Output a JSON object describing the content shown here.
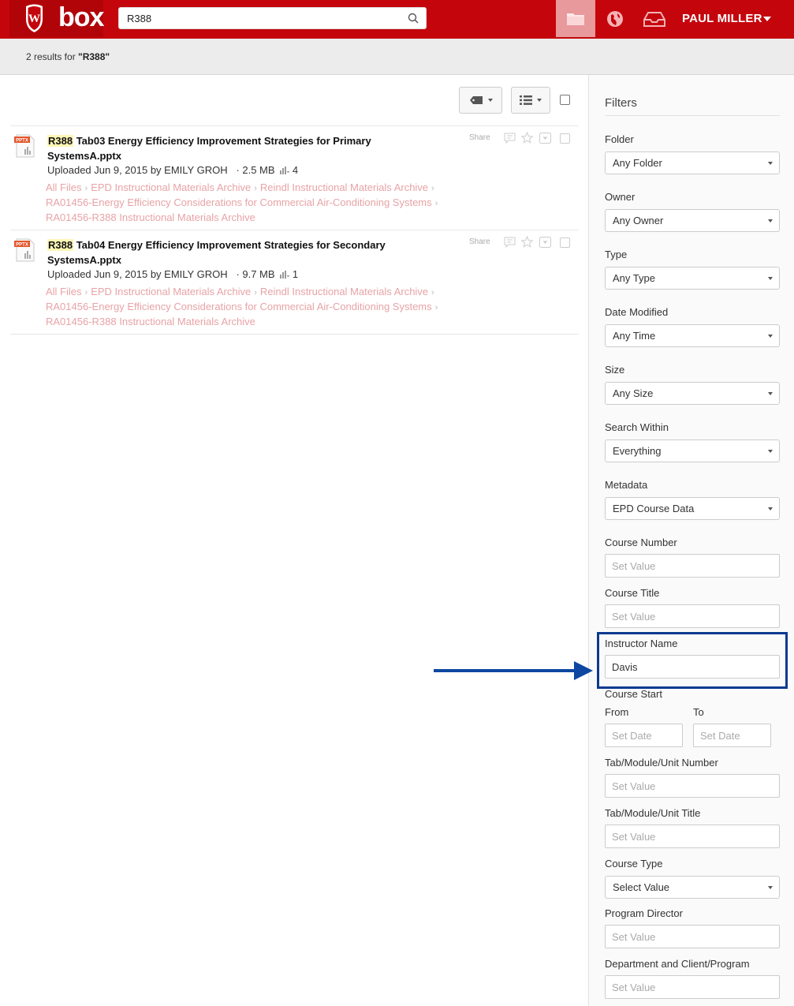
{
  "header": {
    "logo_text": "box",
    "search_value": "R388",
    "username": "PAUL MILLER"
  },
  "results": {
    "prefix": "2 results for ",
    "query_quoted": "\"R388\""
  },
  "files": [
    {
      "hit": "R388",
      "title_rest": " Tab03 Energy Efficiency Improvement Strategies for Primary SystemsA.pptx",
      "meta_prefix": "Uploaded Jun 9, 2015 by EMILY GROH",
      "size": "· 2.5 MB",
      "views": "4",
      "share": "Share",
      "file_type": "PPTX",
      "crumbs": [
        "All Files",
        "EPD Instructional Materials Archive",
        "Reindl Instructional Materials Archive",
        "RA01456-Energy Efficiency Considerations for Commercial Air-Conditioning Systems",
        "RA01456-R388 Instructional Materials Archive"
      ]
    },
    {
      "hit": "R388",
      "title_rest": " Tab04 Energy Efficiency Improvement Strategies for Secondary SystemsA.pptx",
      "meta_prefix": "Uploaded Jun 9, 2015 by EMILY GROH",
      "size": "· 9.7 MB",
      "views": "1",
      "share": "Share",
      "file_type": "PPTX",
      "crumbs": [
        "All Files",
        "EPD Instructional Materials Archive",
        "Reindl Instructional Materials Archive",
        "RA01456-Energy Efficiency Considerations for Commercial Air-Conditioning Systems",
        "RA01456-R388 Instructional Materials Archive"
      ]
    }
  ],
  "filters": {
    "title": "Filters",
    "folder": {
      "label": "Folder",
      "value": "Any Folder"
    },
    "owner": {
      "label": "Owner",
      "value": "Any Owner"
    },
    "type": {
      "label": "Type",
      "value": "Any Type"
    },
    "date_modified": {
      "label": "Date Modified",
      "value": "Any Time"
    },
    "size": {
      "label": "Size",
      "value": "Any Size"
    },
    "search_within": {
      "label": "Search Within",
      "value": "Everything"
    },
    "metadata": {
      "label": "Metadata",
      "value": "EPD Course Data"
    },
    "course_number": {
      "label": "Course Number",
      "placeholder": "Set Value"
    },
    "course_title": {
      "label": "Course Title",
      "placeholder": "Set Value"
    },
    "instructor_name": {
      "label": "Instructor Name",
      "value": "Davis"
    },
    "course_start": {
      "label": "Course Start",
      "from_label": "From",
      "to_label": "To",
      "from_placeholder": "Set Date",
      "to_placeholder": "Set Date"
    },
    "tab_number": {
      "label": "Tab/Module/Unit Number",
      "placeholder": "Set Value"
    },
    "tab_title": {
      "label": "Tab/Module/Unit Title",
      "placeholder": "Set Value"
    },
    "course_type": {
      "label": "Course Type",
      "value": "Select Value"
    },
    "program_director": {
      "label": "Program Director",
      "placeholder": "Set Value"
    },
    "department": {
      "label": "Department and Client/Program",
      "placeholder": "Set Value"
    }
  },
  "colors": {
    "header": "#c5050c",
    "callout": "#0b3a8f",
    "crumbs": "#e8a3a6"
  }
}
